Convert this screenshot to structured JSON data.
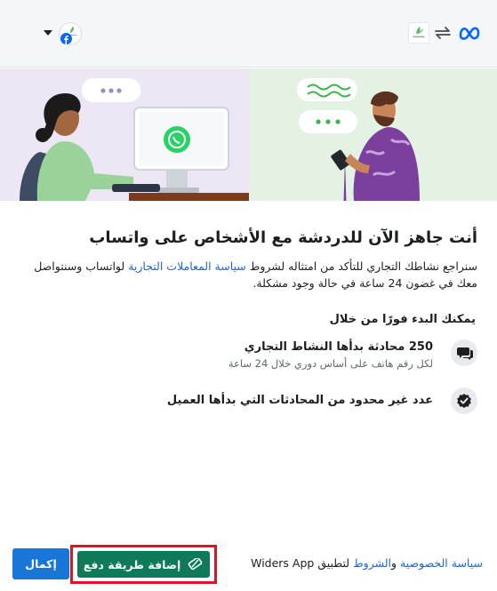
{
  "header": {
    "brand_icon": "meta-logo-icon",
    "sync_icon": "sync-arrows-icon",
    "app_logo_icon": "widers-app-logo-icon",
    "account_badge_icon": "facebook-icon",
    "account_dropdown_icon": "caret-down-icon"
  },
  "main": {
    "title": "أنت جاهز الآن للدردشة مع الأشخاص على واتساب",
    "desc_part1": "سنراجع نشاطك التجاري للتأكد من امتثاله لشروط ",
    "desc_link": "سياسة المعاملات التجارية",
    "desc_part2": " لواتساب وسنتواصل معك في غضون 24 ساعة في حالة وجود مشكلة.",
    "start_label": "يمكنك البدء فورًا من خلال",
    "features": [
      {
        "title": "250 محادثة بدأها النشاط التجاري",
        "subtitle": "لكل رقم هاتف على أساس دوري خلال 24 ساعة",
        "icon": "chat-bubbles-icon"
      },
      {
        "title": "عدد غير محدود من المحادثات التي بدأها العميل",
        "subtitle": "",
        "icon": "verified-check-icon"
      }
    ]
  },
  "footer": {
    "privacy_link": "سياسة الخصوصية",
    "and_word": " و",
    "terms_link": "الشروط",
    "suffix": " لتطبيق Widers App",
    "add_payment_label": "إضافة طريقة دفع",
    "complete_label": "إكمال"
  },
  "colors": {
    "primary_blue": "#1877d6",
    "whatsapp_green": "#0e7a5a",
    "highlight_red": "#e0131e"
  }
}
